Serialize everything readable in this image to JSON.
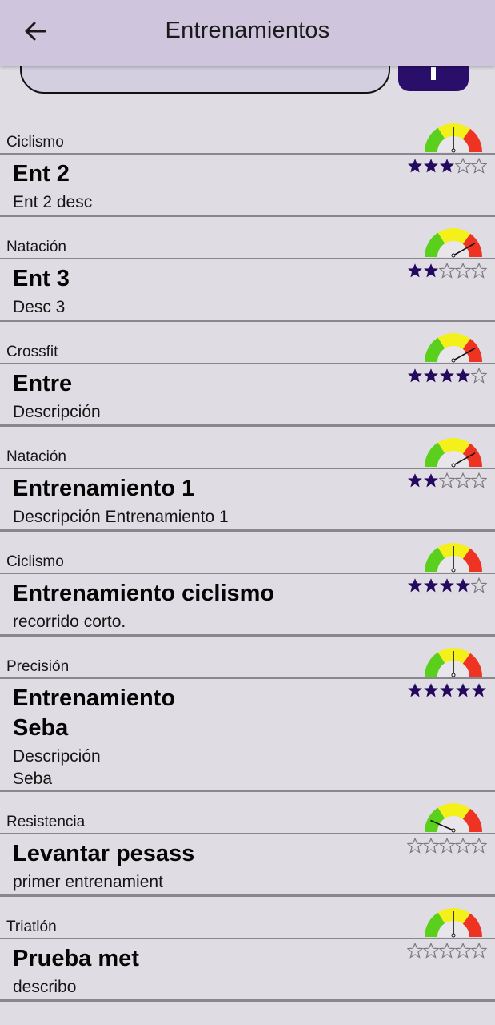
{
  "appbar": {
    "title": "Entrenamientos",
    "back_icon": "arrow-left-icon"
  },
  "search": {
    "placeholder": ""
  },
  "add_button": {
    "icon": "add-icon"
  },
  "colors": {
    "appbar": "#cfc6de",
    "accent": "#2a0f6a",
    "star": "#230a5e",
    "gauge_green": "#5ad01d",
    "gauge_yellow": "#f4f01a",
    "gauge_red": "#ee3322"
  },
  "trainings": [
    {
      "category": "Ciclismo",
      "title": "Ent 2",
      "description": "Ent 2 desc",
      "rating": 3,
      "intensity": 0.5
    },
    {
      "category": "Natación",
      "title": "Ent 3",
      "description": "Desc 3",
      "rating": 2,
      "intensity": 0.82
    },
    {
      "category": "Crossfit",
      "title": "Entre",
      "description": "Descripción",
      "rating": 4,
      "intensity": 0.82
    },
    {
      "category": "Natación",
      "title": "Entrenamiento 1",
      "description": "Descripción Entrenamiento 1",
      "rating": 2,
      "intensity": 0.82
    },
    {
      "category": "Ciclismo",
      "title": "Entrenamiento ciclismo",
      "description": "recorrido corto.",
      "rating": 4,
      "intensity": 0.5
    },
    {
      "category": "Precisión",
      "title": "Entrenamiento Seba",
      "description": "Descripción Seba",
      "rating": 5,
      "intensity": 0.5
    },
    {
      "category": "Resistencia",
      "title": "Levantar pesass",
      "description": "primer entrenamient",
      "rating": 0,
      "intensity": 0.15
    },
    {
      "category": "Triatlón",
      "title": "Prueba met",
      "description": "describo",
      "rating": 0,
      "intensity": 0.5
    }
  ]
}
